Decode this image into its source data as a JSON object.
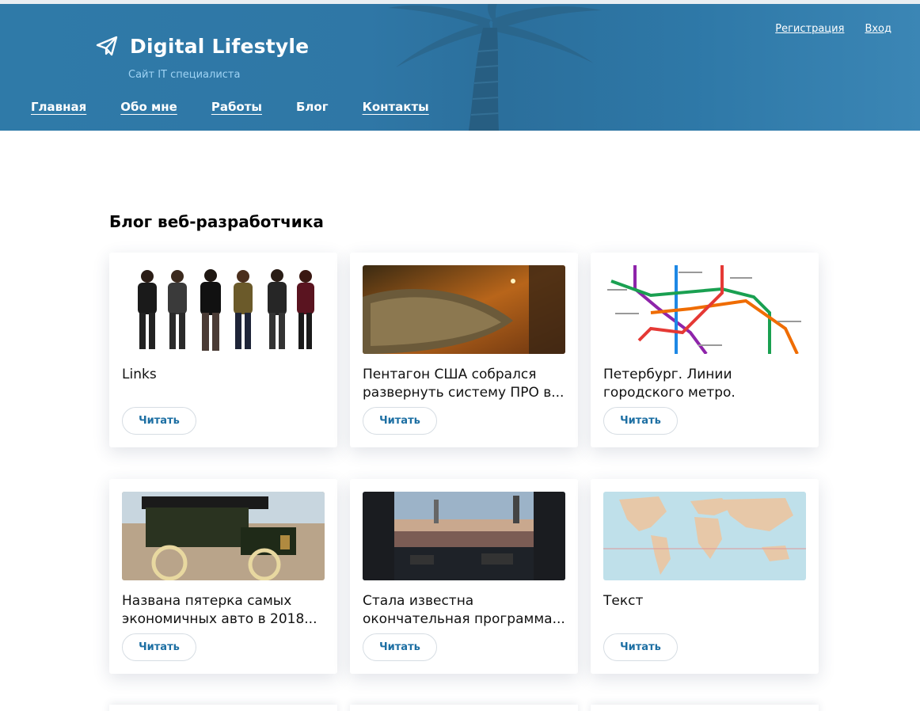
{
  "brand": {
    "title": "Digital Lifestyle",
    "subtitle": "Сайт IT специалиста",
    "icon": "paper-plane-icon"
  },
  "auth": {
    "register": "Регистрация",
    "login": "Вход"
  },
  "nav": {
    "items": [
      {
        "label": "Главная"
      },
      {
        "label": "Обо мне"
      },
      {
        "label": "Работы"
      },
      {
        "label": "Блог"
      },
      {
        "label": "Контакты"
      }
    ]
  },
  "main": {
    "title": "Блог веб-разработчика",
    "read_label": "Читать",
    "posts": [
      {
        "title": "Links",
        "image": "people-illustration"
      },
      {
        "title": "Пентагон США собрался развернуть систему ПРО в...",
        "image": "spaceship"
      },
      {
        "title": "Петербург. Линии городского метро.",
        "image": "metro-map"
      },
      {
        "title": "Названа пятерка самых экономичных авто в 2018...",
        "image": "vintage-car"
      },
      {
        "title": "Стала известна окончательная программа...",
        "image": "concert-crowd"
      },
      {
        "title": "Текст",
        "image": "world-map"
      }
    ]
  },
  "colors": {
    "header": "#2f78a7",
    "accent": "#1d6fa3",
    "subtitle": "#9fd3f4"
  }
}
